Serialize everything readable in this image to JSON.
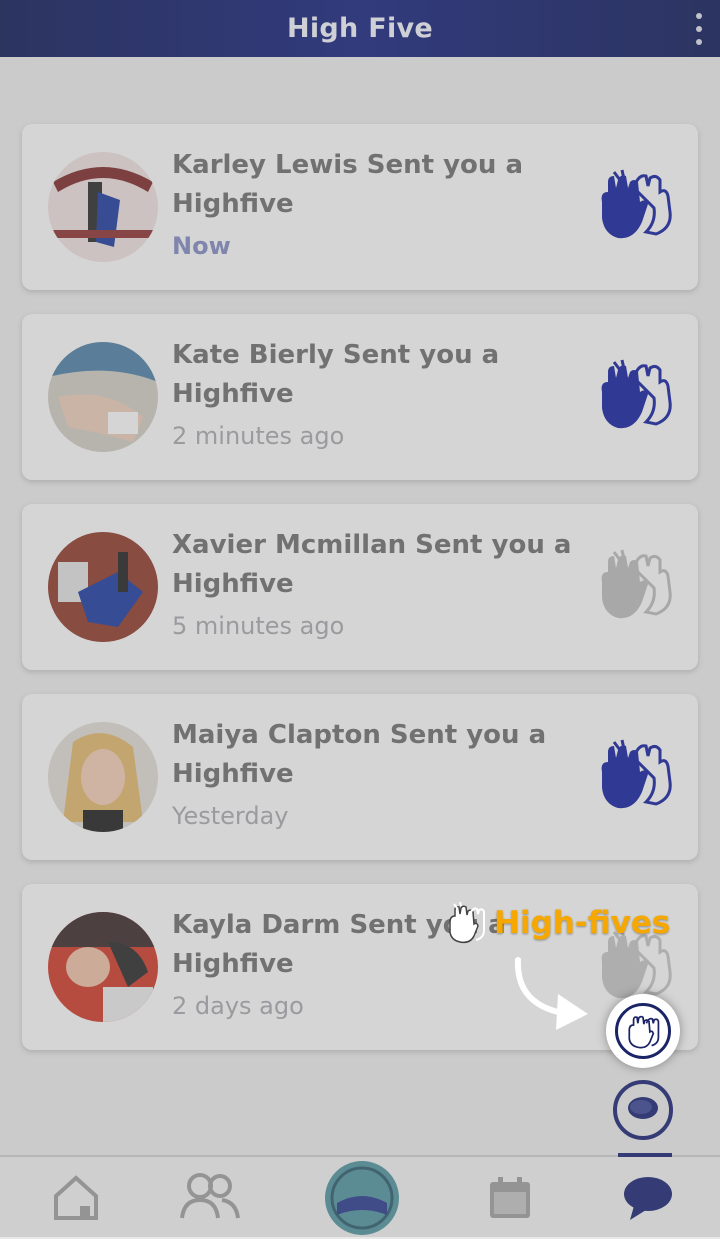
{
  "app": {
    "title": "High Five"
  },
  "notifications": [
    {
      "name": "Karley Lewis",
      "text": "Karley Lewis  Sent you a Highfive",
      "time": "Now",
      "icon_state": "active"
    },
    {
      "name": "Kate Bierly",
      "text": "Kate Bierly Sent you a Highfive",
      "time": "2 minutes ago",
      "icon_state": "active"
    },
    {
      "name": "Xavier Mcmillan",
      "text": "Xavier Mcmillan Sent you a Highfive",
      "time": "5 minutes ago",
      "icon_state": "inactive"
    },
    {
      "name": "Maiya Clapton",
      "text": "Maiya Clapton Sent you a Highfive",
      "time": "Yesterday",
      "icon_state": "active"
    },
    {
      "name": "Kayla Darm",
      "text": "Kayla Darm Sent you a Highfive",
      "time": "2 days ago",
      "icon_state": "inactive"
    }
  ],
  "tooltip": {
    "label": "High-fives",
    "icon": "high-five-hands-icon"
  },
  "fab": {
    "highfive_icon": "high-five-hands-icon",
    "chat_icon": "chat-bubble-icon"
  },
  "nav": {
    "items": [
      {
        "icon": "home-icon"
      },
      {
        "icon": "people-icon"
      },
      {
        "icon": "team-logo-icon"
      },
      {
        "icon": "calendar-icon"
      },
      {
        "icon": "chat-icon",
        "active": true
      }
    ]
  },
  "colors": {
    "header": "#17237a",
    "accent": "#1b2570",
    "highlight": "#f6a800",
    "icon_active": "#14209a",
    "icon_inactive": "#b0b0b0"
  }
}
